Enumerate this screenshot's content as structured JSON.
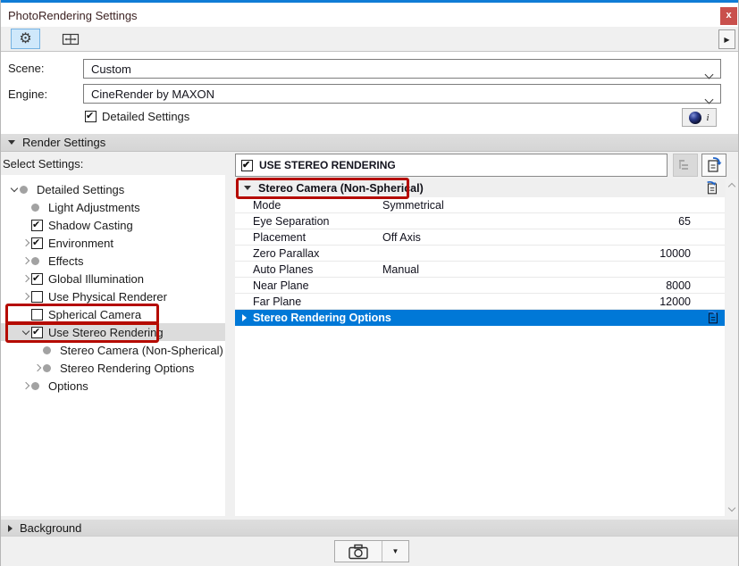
{
  "window": {
    "title": "PhotoRendering Settings",
    "close_label": "x"
  },
  "toolbar": {
    "expand_label": "▶"
  },
  "form": {
    "scene_label": "Scene:",
    "scene_value": "Custom",
    "engine_label": "Engine:",
    "engine_value": "CineRender by MAXON",
    "detailed_settings_label": "Detailed Settings",
    "detailed_settings_checked": true,
    "info_label": "i"
  },
  "sections": {
    "render_settings_label": "Render Settings",
    "background_label": "Background"
  },
  "left_panel": {
    "select_settings_label": "Select Settings:",
    "tree": [
      {
        "label": "Detailed Settings",
        "level": 0,
        "expander": "expanded",
        "icon": "dot",
        "selected": false,
        "red_boxed": false
      },
      {
        "label": "Light Adjustments",
        "level": 1,
        "expander": "none",
        "icon": "dot",
        "selected": false,
        "red_boxed": false
      },
      {
        "label": "Shadow Casting",
        "level": 1,
        "expander": "none",
        "icon": "checked",
        "selected": false,
        "red_boxed": false
      },
      {
        "label": "Environment",
        "level": 1,
        "expander": "collapsed",
        "icon": "checked",
        "selected": false,
        "red_boxed": false
      },
      {
        "label": "Effects",
        "level": 1,
        "expander": "collapsed",
        "icon": "dot",
        "selected": false,
        "red_boxed": false
      },
      {
        "label": "Global Illumination",
        "level": 1,
        "expander": "collapsed",
        "icon": "checked",
        "selected": false,
        "red_boxed": false
      },
      {
        "label": "Use Physical Renderer",
        "level": 1,
        "expander": "collapsed",
        "icon": "unchecked",
        "selected": false,
        "red_boxed": false
      },
      {
        "label": "Spherical Camera",
        "level": 1,
        "expander": "none",
        "icon": "unchecked",
        "selected": false,
        "red_boxed": true
      },
      {
        "label": "Use Stereo Rendering",
        "level": 1,
        "expander": "expanded",
        "icon": "checked",
        "selected": true,
        "red_boxed": true
      },
      {
        "label": "Stereo Camera (Non-Spherical)",
        "level": 2,
        "expander": "none",
        "icon": "dot",
        "selected": false,
        "red_boxed": false
      },
      {
        "label": "Stereo Rendering Options",
        "level": 2,
        "expander": "collapsed",
        "icon": "dot",
        "selected": false,
        "red_boxed": false
      },
      {
        "label": "Options",
        "level": 1,
        "expander": "collapsed",
        "icon": "dot",
        "selected": false,
        "red_boxed": false
      }
    ]
  },
  "right_panel": {
    "use_stereo_label": "USE STEREO RENDERING",
    "use_stereo_checked": true,
    "group_header_label": "Stereo Camera (Non-Spherical)",
    "rows": [
      {
        "label": "Mode",
        "value": "Symmetrical",
        "align": "left"
      },
      {
        "label": "Eye Separation",
        "value": "65",
        "align": "right"
      },
      {
        "label": "Placement",
        "value": "Off Axis",
        "align": "left"
      },
      {
        "label": "Zero Parallax",
        "value": "10000",
        "align": "right"
      },
      {
        "label": "Auto Planes",
        "value": "Manual",
        "align": "left"
      },
      {
        "label": "Near Plane",
        "value": "8000",
        "align": "right"
      },
      {
        "label": "Far Plane",
        "value": "12000",
        "align": "right"
      }
    ],
    "footer_group_label": "Stereo Rendering Options"
  },
  "bottom_bar": {
    "camera_dropdown_arrow": "▼"
  },
  "colors": {
    "accent_blue": "#0078d7",
    "titlebar_line_blue": "#0f7cd6",
    "annotation_red": "#b50b00",
    "close_button_red": "#c9504c",
    "selected_tree_row": "#dcdcdc",
    "section_header_gray": "#d8d8d8",
    "selected_tool_bg": "#cfe8fb"
  }
}
